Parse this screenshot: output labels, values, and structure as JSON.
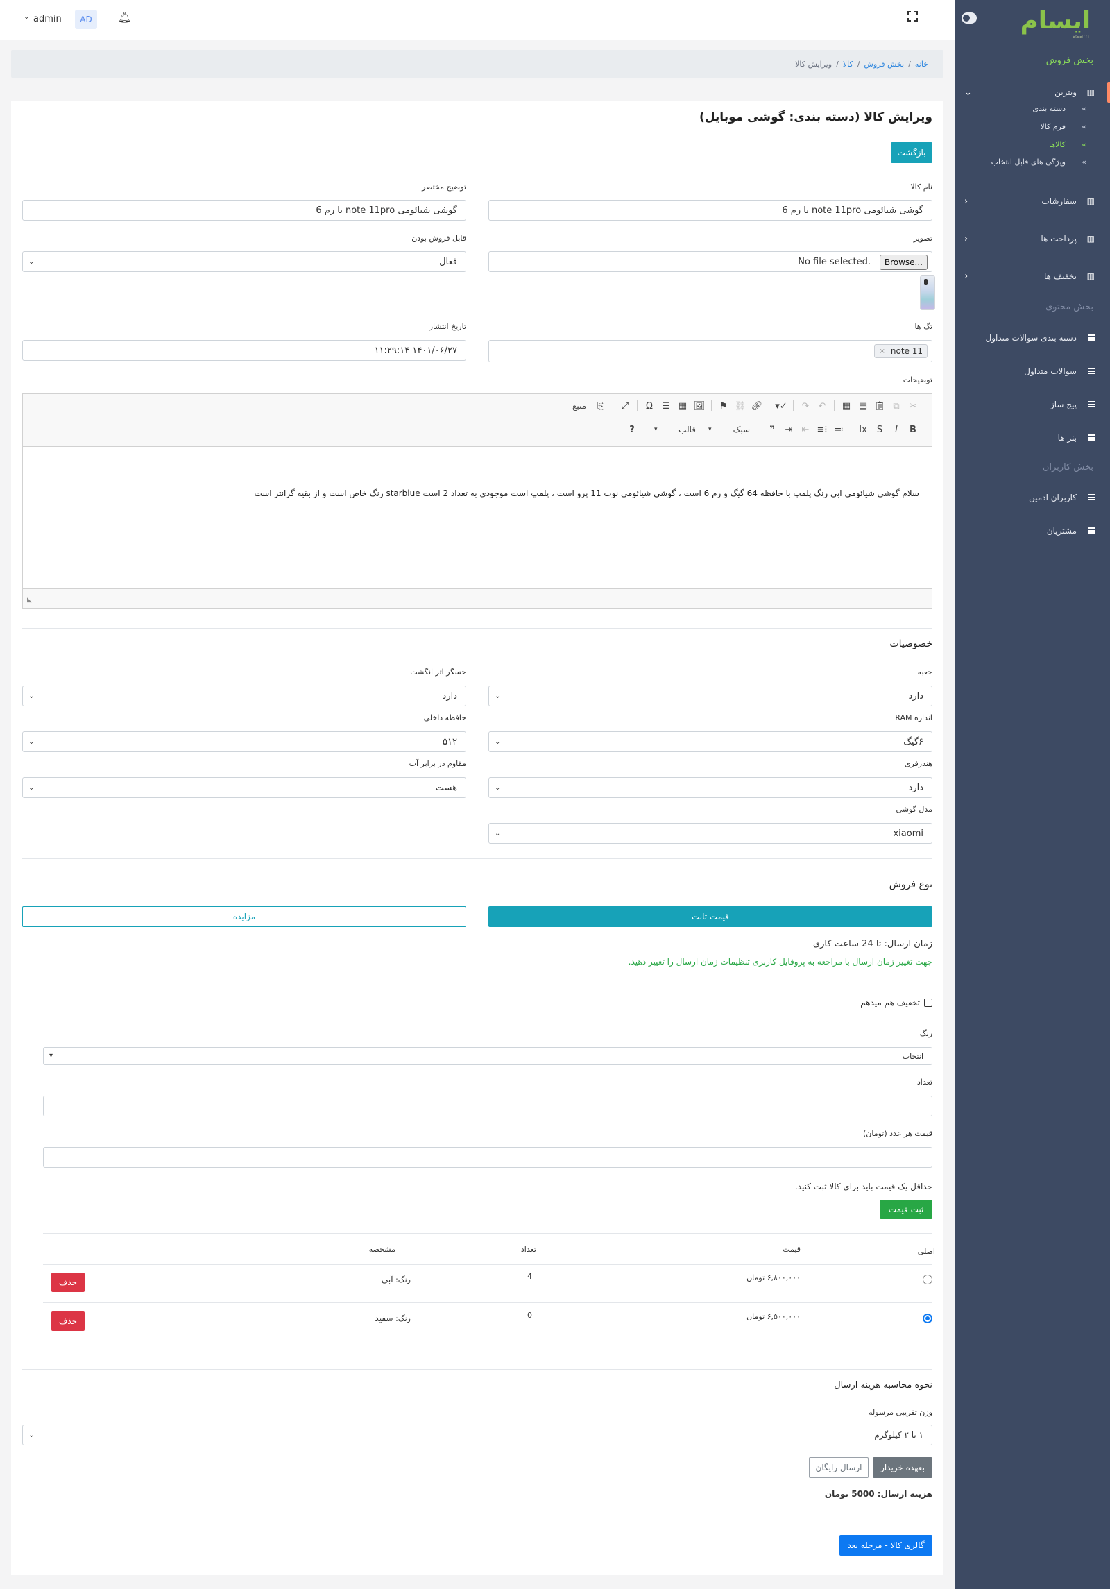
{
  "sidebar": {
    "logo_text": "ایسام",
    "logo_sub": "esam",
    "sales_heading": "بخش فروش",
    "content_heading": "بخش محتوی",
    "users_heading": "بخش کاربران",
    "items": [
      {
        "label": "ویترین",
        "icon": "chart-icon",
        "expanded": true
      },
      {
        "label": "سفارشات",
        "icon": "chart-icon"
      },
      {
        "label": "پرداخت ها",
        "icon": "chart-icon"
      },
      {
        "label": "تخفیف ها",
        "icon": "chart-icon"
      },
      {
        "label": "دسته بندی سوالات متداول",
        "icon": "bars-icon"
      },
      {
        "label": "سوالات متداول",
        "icon": "bars-icon"
      },
      {
        "label": "پیج ساز",
        "icon": "bars-icon"
      },
      {
        "label": "بنر ها",
        "icon": "bars-icon"
      },
      {
        "label": "کاربران ادمین",
        "icon": "bars-icon"
      },
      {
        "label": "مشتریان",
        "icon": "bars-icon"
      }
    ],
    "subitems": [
      {
        "label": "دسته بندی"
      },
      {
        "label": "فرم کالا"
      },
      {
        "label": "کالاها",
        "active": true
      },
      {
        "label": "ویژگی های قابل انتخاب"
      }
    ],
    "colors": {
      "background": "#3d4a63",
      "active": "#8bdc5a"
    }
  },
  "topbar": {
    "user_name": "admin",
    "avatar_initials": "AD"
  },
  "breadcrumb": {
    "home": "خانه",
    "sep": "/",
    "sales": "بخش فروش",
    "products": "کالا",
    "current": "ویرایش کالا"
  },
  "form": {
    "title": "ویرایش کالا (دسته بندی: گوشی موبایل)",
    "back_button": "بازگشت",
    "name_label": "نام کالا",
    "name_value": "گوشی شیائومی note 11pro با رم 6",
    "intro_label": "توضیح مختصر",
    "intro_value": "گوشی شیائومی note 11pro با رم 6",
    "image_label": "تصویر",
    "file_button": "Browse...",
    "file_status": "No file selected.",
    "marketable_label": "قابل فروش بودن",
    "marketable_value": "فعال",
    "tags_label": "تگ ها",
    "tag_value": "note 11",
    "tag_remove": "×",
    "published_label": "تاریخ انتشار",
    "published_value": "۱۴۰۱/۰۶/۲۷  ۱۱:۲۹:۱۴",
    "description_label": "توضیحات",
    "description_text": "سلام گوشی شیائومی ابی رنگ پلمپ با حافظه 64 گیگ و رم 6 است ، گوشی شیائومی نوت 11 پرو است ، پلمپ است موجودی به تعداد 2 است starblue رنگ خاص است و از بقیه گرانتر است",
    "editor": {
      "source_label": "منبع",
      "style_label": "سبک",
      "format_label": "قالب",
      "help": "?"
    }
  },
  "properties": {
    "heading": "خصوصیات",
    "fields": [
      {
        "label": "جعبه",
        "value": "دارد"
      },
      {
        "label": "حسگر اثر انگشت",
        "value": "دارد"
      },
      {
        "label": "اندازه RAM",
        "value": "۶گیگ"
      },
      {
        "label": "حافظه داخلی",
        "value": "۵۱۲"
      },
      {
        "label": "هندزفری",
        "value": "دارد"
      },
      {
        "label": "مقاوم در برابر آب",
        "value": "هست"
      },
      {
        "label": "مدل گوشی",
        "value": "xiaomi"
      }
    ]
  },
  "sale_type": {
    "heading": "نوع فروش",
    "fixed_price": "قیمت ثابت",
    "auction": "مزایده",
    "delivery_time": "زمان ارسال: تا 24 ساعت کاری",
    "delivery_hint": "جهت تغییر زمان ارسال با مراجعه به پروفایل کاربری تنظیمات زمان ارسال را تغییر دهید.",
    "discount_label": "تخفیف هم میدهم",
    "color_label": "رنگ",
    "color_value": "انتخاب",
    "count_label": "تعداد",
    "count_value": "",
    "price_label": "قیمت هر عدد (تومان)",
    "price_value": "",
    "min_price_hint": "حداقل یک قیمت باید برای کالا ثبت کنید.",
    "submit_price": "ثبت قیمت",
    "table": {
      "headers": {
        "main": "اصلی",
        "price": "قیمت",
        "count": "تعداد",
        "spec": "مشخصه"
      },
      "rows": [
        {
          "main": false,
          "price": "۶,۸۰۰,۰۰۰ تومان",
          "count": "4",
          "spec_key": "رنگ:",
          "spec_value": "آبی",
          "delete": "حذف"
        },
        {
          "main": true,
          "price": "۶,۵۰۰,۰۰۰ تومان",
          "count": "0",
          "spec_key": "رنگ:",
          "spec_value": "سفید",
          "delete": "حذف"
        }
      ]
    }
  },
  "shipping": {
    "heading": "نحوه محاسبه هزینه ارسال",
    "weight_label": "وزن تقریبی مرسوله",
    "weight_value": "۱ تا ۲ کیلوگرم",
    "buyer_pays": "بعهده خریدار",
    "free_shipping": "ارسال رایگان",
    "cost": "هزینه ارسال: 5000 تومان",
    "next_button": "گالری کالا - مرحله بعد"
  }
}
